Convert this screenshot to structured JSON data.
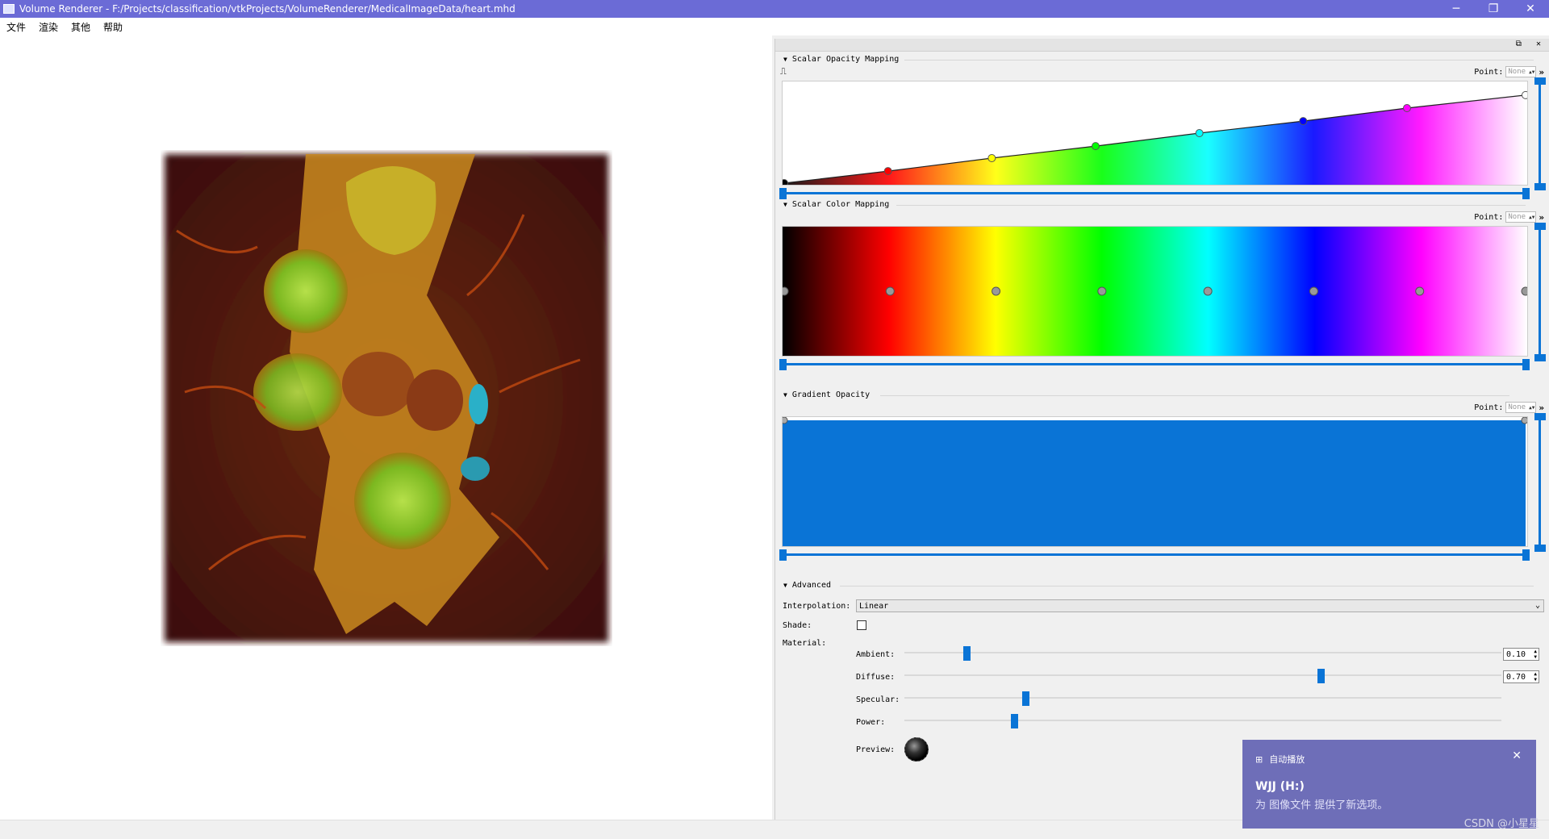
{
  "window": {
    "title": "Volume Renderer - F:/Projects/classification/vtkProjects/VolumeRenderer/MedicalImageData/heart.mhd",
    "controls": {
      "minimize": "─",
      "restore": "❐",
      "close": "✕"
    }
  },
  "menu": {
    "items": [
      "文件",
      "渲染",
      "其他",
      "帮助"
    ]
  },
  "dock": {
    "float_label": "⧉",
    "close_label": "✕",
    "opacity": {
      "title": "Scalar Opacity Mapping",
      "point_label": "Point:",
      "point_value": "None",
      "expand": "»",
      "points": [
        [
          0.0,
          0.0
        ],
        [
          0.14,
          0.12
        ],
        [
          0.28,
          0.25
        ],
        [
          0.42,
          0.37
        ],
        [
          0.56,
          0.5
        ],
        [
          0.7,
          0.62
        ],
        [
          0.84,
          0.75
        ],
        [
          1.0,
          0.88
        ]
      ]
    },
    "color": {
      "title": "Scalar Color Mapping",
      "point_label": "Point:",
      "point_value": "None",
      "expand": "»",
      "stops": [
        "#000000",
        "#ff0000",
        "#ffff00",
        "#00ff00",
        "#00ffff",
        "#0000ff",
        "#ff00ff",
        "#ffffff"
      ]
    },
    "gradient": {
      "title": "Gradient Opacity",
      "point_label": "Point:",
      "point_value": "None",
      "expand": "»",
      "fill": "#0a74d6"
    },
    "advanced": {
      "title": "Advanced",
      "interpolation_label": "Interpolation:",
      "interpolation_value": "Linear",
      "shade_label": "Shade:",
      "shade_checked": false,
      "material_label": "Material:",
      "ambient_label": "Ambient:",
      "ambient_value": "0.10",
      "ambient_pos": 0.1,
      "diffuse_label": "Diffuse:",
      "diffuse_value": "0.70",
      "diffuse_pos": 0.7,
      "specular_label": "Specular:",
      "specular_pos": 0.2,
      "power_label": "Power:",
      "power_pos": 0.18,
      "preview_label": "Preview:"
    }
  },
  "toast": {
    "header": "自动播放",
    "title": "WJJ (H:)",
    "body": "为 图像文件 提供了新选项。",
    "close": "✕"
  },
  "watermark": "CSDN @小星星"
}
